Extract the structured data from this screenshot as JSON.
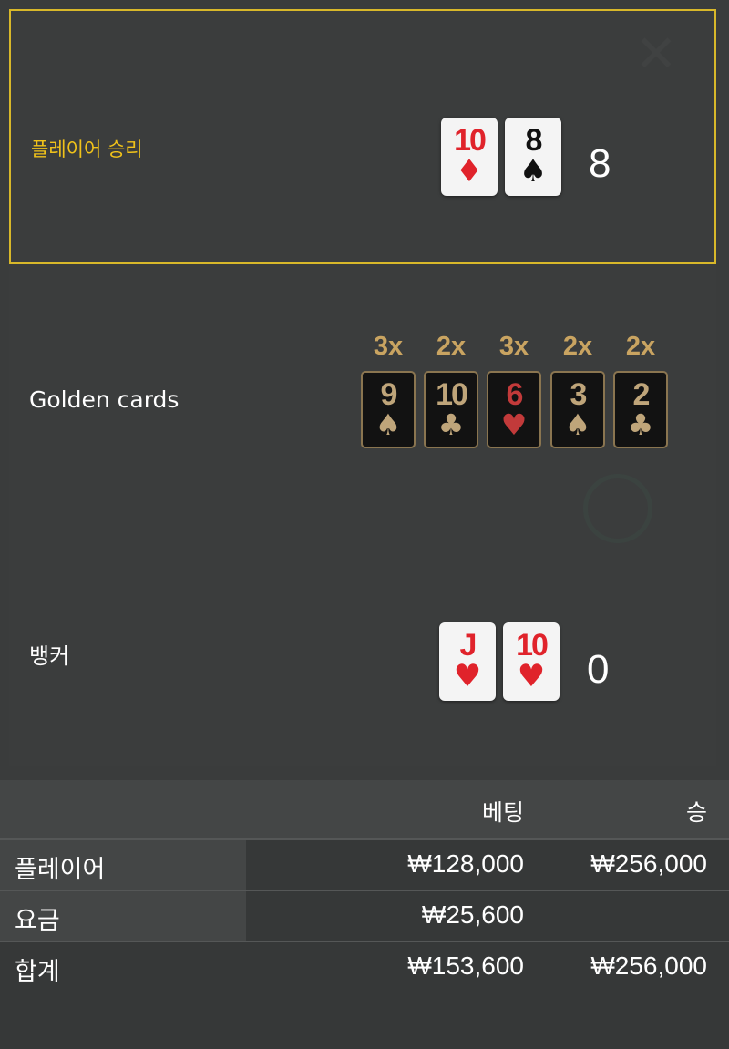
{
  "result": {
    "player": {
      "label": "플레이어 승리",
      "score": "8",
      "cards": [
        {
          "rank": "10",
          "suit": "♦",
          "color": "red"
        },
        {
          "rank": "8",
          "suit": "♠",
          "color": "black"
        }
      ]
    },
    "golden": {
      "label": "Golden cards",
      "cards": [
        {
          "multiplier": "3x",
          "rank": "9",
          "suit": "♠",
          "color": "gold"
        },
        {
          "multiplier": "2x",
          "rank": "10",
          "suit": "♣",
          "color": "gold"
        },
        {
          "multiplier": "3x",
          "rank": "6",
          "suit": "♥",
          "color": "red"
        },
        {
          "multiplier": "2x",
          "rank": "3",
          "suit": "♠",
          "color": "gold"
        },
        {
          "multiplier": "2x",
          "rank": "2",
          "suit": "♣",
          "color": "gold"
        }
      ]
    },
    "banker": {
      "label": "뱅커",
      "score": "0",
      "cards": [
        {
          "rank": "J",
          "suit": "♥",
          "color": "red"
        },
        {
          "rank": "10",
          "suit": "♥",
          "color": "red"
        }
      ]
    }
  },
  "summary": {
    "headers": {
      "bet": "베팅",
      "win": "승"
    },
    "rows": [
      {
        "label": "플레이어",
        "bet": "₩128,000",
        "win": "₩256,000"
      },
      {
        "label": "요금",
        "bet": "₩25,600",
        "win": ""
      },
      {
        "label": "합계",
        "bet": "₩153,600",
        "win": "₩256,000"
      }
    ]
  },
  "colors": {
    "win_border": "#d8b82a",
    "win_label": "#f0c21a",
    "red_suit": "#e0232b",
    "golden_accent": "#c9a461"
  }
}
